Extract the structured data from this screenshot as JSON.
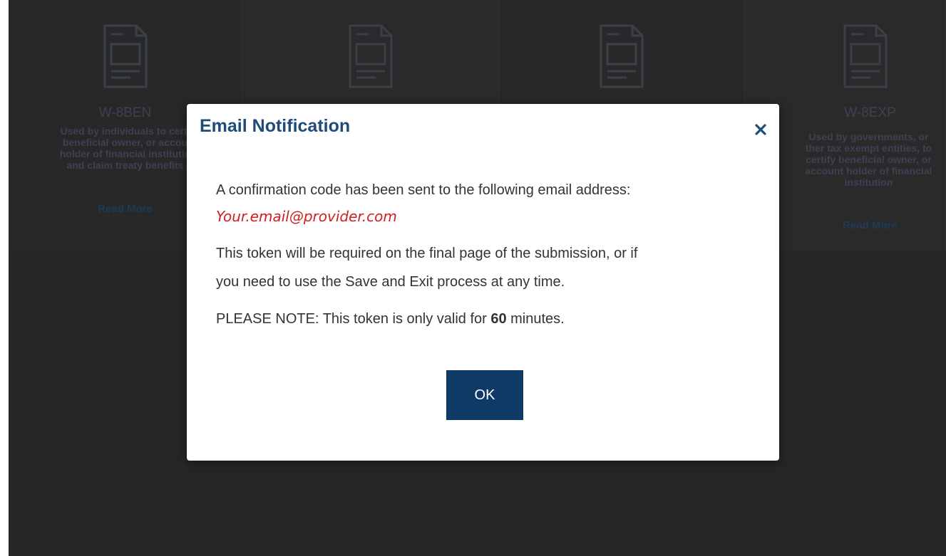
{
  "background_cards": [
    {
      "name": "W-8BEN",
      "desc_lines": [
        "Used by individuals to certi",
        "beneficial owner, or accou",
        "holder of financial institutio",
        "and claim treaty benefits"
      ],
      "read_more": "Read More"
    },
    {
      "name": "",
      "desc_lines": [],
      "read_more": ""
    },
    {
      "name": "",
      "desc_lines": [],
      "read_more": ""
    },
    {
      "name": "W-8EXP",
      "desc_lines": [
        "Used by governments, or",
        "ther tax exempt entities, to",
        "certify beneficial owner, or",
        "account holder of financial",
        "institution"
      ],
      "read_more": "Read More"
    }
  ],
  "modal": {
    "title": "Email Notification",
    "close_symbol": "×",
    "intro": "A confirmation code has been sent to the following email address:",
    "email": "Your.email@provider.com",
    "token_line1": "This token will be required on the final page of the submission, or if",
    "token_line2": "you need to use the Save and Exit process at any time.",
    "note_prefix": "PLEASE NOTE: This token is only valid for ",
    "note_minutes": "60",
    "note_suffix": " minutes.",
    "ok_label": "OK"
  },
  "colors": {
    "title": "#1e4b7a",
    "email": "#d11f1f",
    "ok_button": "#0f3a66",
    "overlay": "#262626"
  }
}
